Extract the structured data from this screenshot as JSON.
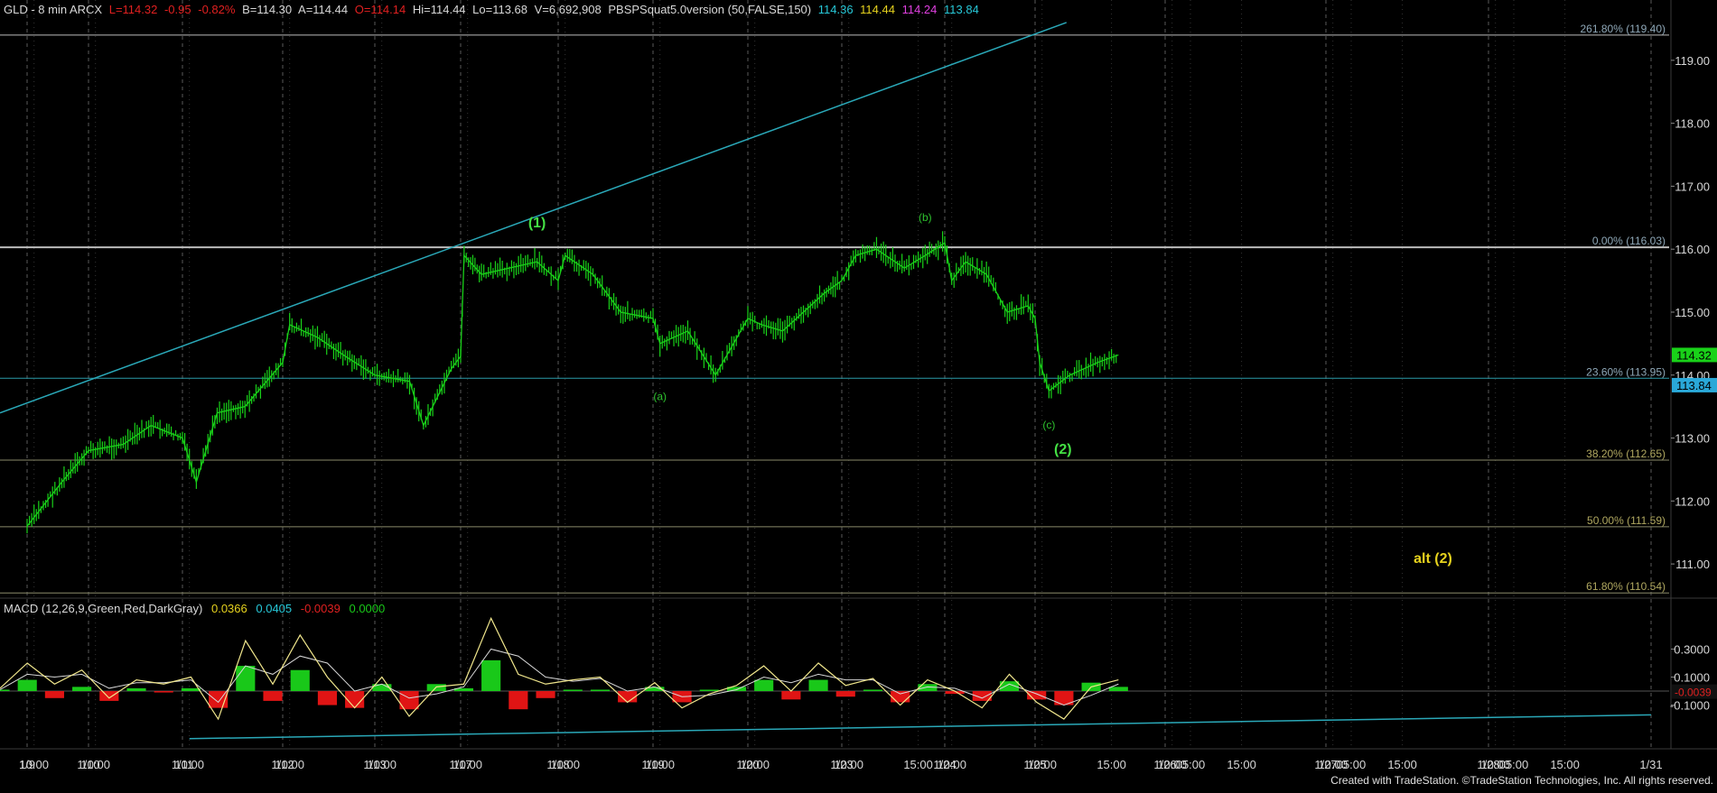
{
  "header": {
    "symbol": "GLD - 8 min  ARCX",
    "last": "L=114.32",
    "chg": "-0.95",
    "pct": "-0.82%",
    "bid": "B=114.30",
    "ask": "A=114.44",
    "open": "O=114.14",
    "hi": "Hi=114.44",
    "lo": "Lo=113.68",
    "vol": "V=6,692,908",
    "indicator": "PBSPSquat5.0version (50,FALSE,150)",
    "ind_v1": "114.36",
    "ind_v2": "114.44",
    "ind_v3": "114.24",
    "ind_v4": "113.84"
  },
  "macd_header": {
    "label": "MACD (12,26,9,Green,Red,DarkGray)",
    "v1": "0.0366",
    "v2": "0.0405",
    "v3": "-0.0039",
    "v4": "0.0000"
  },
  "colors": {
    "background": "#000000",
    "price": "#19d219",
    "trendline": "#2aa8b8",
    "fib_line": "#8a8a8a",
    "wave_label": "#2ec22e",
    "alt_label": "#e6d21e",
    "macd_line": "#f0e68c",
    "signal_line": "#d8d8d8",
    "hist_pos": "#19c819",
    "hist_neg": "#e01414",
    "cyan_text": "#27c8d8",
    "yellow_text": "#e6d21e",
    "magenta_text": "#e040e0",
    "red_text": "#e02020",
    "green_text": "#19c819"
  },
  "chart_data": [
    {
      "type": "line",
      "title": "GLD - 8 min ARCX",
      "y_range": [
        110.5,
        119.7
      ],
      "y_ticks": [
        "111.00",
        "112.00",
        "113.00",
        "114.00",
        "115.00",
        "116.00",
        "117.00",
        "118.00",
        "119.00"
      ],
      "x_tick_labels": [
        "1/9",
        "10:00",
        "1/10",
        "10:00",
        "1/11",
        "10:00",
        "1/12",
        "10:00",
        "1/13",
        "10:00",
        "1/17",
        "10:00",
        "1/18",
        "10:00",
        "1/19",
        "10:00",
        "1/20",
        "10:00",
        "1/23",
        "10:00",
        "15:00",
        "1/24",
        "10:00",
        "1/25",
        "10:00",
        "15:00",
        "1/26",
        "05:00",
        "10:00",
        "15:00",
        "1/27",
        "05:00",
        "10:00",
        "15:00",
        "1/28",
        "05:00",
        "10:00",
        "15:00",
        "1/31"
      ],
      "price_series": {
        "name": "GLD",
        "x": [
          "1/9 09:30",
          "1/9 12:00",
          "1/10 09:30",
          "1/10 12:00",
          "1/10 14:00",
          "1/11 09:30",
          "1/11 10:30",
          "1/11 12:00",
          "1/11 14:00",
          "1/12 09:30",
          "1/12 10:00",
          "1/12 12:00",
          "1/12 14:00",
          "1/13 09:30",
          "1/13 12:00",
          "1/13 13:00",
          "1/13 15:00",
          "1/17 09:30",
          "1/17 09:45",
          "1/17 11:00",
          "1/17 13:00",
          "1/17 15:00",
          "1/18 09:30",
          "1/18 10:00",
          "1/18 12:00",
          "1/18 14:00",
          "1/19 09:30",
          "1/19 10:00",
          "1/19 12:00",
          "1/19 14:00",
          "1/20 09:30",
          "1/20 10:30",
          "1/20 12:00",
          "1/20 15:00",
          "1/23 09:30",
          "1/23 10:30",
          "1/23 12:00",
          "1/23 14:00",
          "1/23 15:30",
          "1/24 09:30",
          "1/24 10:00",
          "1/24 11:00",
          "1/24 12:30",
          "1/24 14:00",
          "1/24 15:30",
          "1/25 09:30",
          "1/25 09:50",
          "1/25 10:30",
          "1/25 12:00",
          "1/25 14:00",
          "1/25 15:30"
        ],
        "values": [
          111.6,
          112.3,
          112.8,
          112.9,
          113.2,
          113.0,
          112.3,
          113.4,
          113.5,
          114.2,
          114.8,
          114.6,
          114.3,
          114.0,
          113.9,
          113.2,
          114.1,
          114.3,
          115.9,
          115.6,
          115.7,
          115.8,
          115.5,
          115.9,
          115.6,
          115.0,
          114.9,
          114.5,
          114.7,
          114.0,
          114.9,
          114.8,
          114.7,
          115.3,
          115.5,
          115.9,
          116.0,
          115.7,
          115.9,
          116.1,
          115.5,
          115.8,
          115.6,
          115.0,
          115.1,
          114.9,
          114.2,
          113.75,
          114.0,
          114.2,
          114.32
        ]
      },
      "fib_levels": [
        {
          "label": "261.80% (119.40)",
          "value": 119.4
        },
        {
          "label": "0.00% (116.03)",
          "value": 116.03
        },
        {
          "label": "23.60% (113.95)",
          "value": 113.95
        },
        {
          "label": "38.20% (112.65)",
          "value": 112.65
        },
        {
          "label": "50.00% (111.59)",
          "value": 111.59
        },
        {
          "label": "61.80% (110.54)",
          "value": 110.54
        }
      ],
      "trendlines": [
        {
          "from": [
            "1/9 09:30",
            113.4
          ],
          "to": [
            "1/26 05:00",
            119.6
          ]
        }
      ],
      "wave_labels": [
        {
          "text": "(1)",
          "x": "1/17 15:00",
          "y": 116.35
        },
        {
          "text": "(b)",
          "x": "1/23 15:30",
          "y": 116.45
        },
        {
          "text": "(a)",
          "x": "1/19 10:00",
          "y": 113.6
        },
        {
          "text": "(c)",
          "x": "1/25 10:30",
          "y": 113.15
        },
        {
          "text": "(2)",
          "x": "1/25 11:30",
          "y": 112.75
        }
      ],
      "alt_label": {
        "text": "alt (2)",
        "x": "1/27 12:00",
        "y": 111.3
      },
      "last_price_tags": [
        "114.32",
        "113.84"
      ],
      "grid": true
    },
    {
      "type": "line",
      "title": "MACD (12,26,9,Green,Red,DarkGray)",
      "y_range": [
        -0.38,
        0.58
      ],
      "y_ticks": [
        "0.3000",
        "0.1000",
        "-0.1000"
      ],
      "last_value_tag": "-0.0039",
      "series": [
        {
          "name": "MACD",
          "values": [
            0.02,
            0.2,
            0.05,
            0.15,
            -0.05,
            0.08,
            0.05,
            0.1,
            -0.2,
            0.36,
            0.05,
            0.4,
            0.1,
            -0.12,
            0.1,
            -0.18,
            0.03,
            0.05,
            0.52,
            0.12,
            0.05,
            0.08,
            0.1,
            -0.08,
            0.06,
            -0.12,
            -0.02,
            0.04,
            0.18,
            0.0,
            0.2,
            0.04,
            0.09,
            -0.1,
            0.08,
            0.0,
            -0.12,
            0.12,
            -0.08,
            -0.2,
            0.03,
            0.08
          ]
        },
        {
          "name": "Signal",
          "values": [
            0.01,
            0.12,
            0.1,
            0.12,
            0.02,
            0.06,
            0.06,
            0.08,
            -0.08,
            0.18,
            0.12,
            0.25,
            0.2,
            0.0,
            0.05,
            -0.05,
            -0.02,
            0.03,
            0.3,
            0.25,
            0.1,
            0.07,
            0.09,
            0.0,
            0.03,
            -0.04,
            -0.03,
            0.01,
            0.1,
            0.06,
            0.12,
            0.08,
            0.08,
            -0.02,
            0.03,
            0.02,
            -0.05,
            0.05,
            -0.02,
            -0.1,
            -0.03,
            0.05
          ]
        },
        {
          "name": "Histogram",
          "values": [
            0.01,
            0.08,
            -0.05,
            0.03,
            -0.07,
            0.02,
            -0.01,
            0.02,
            -0.12,
            0.18,
            -0.07,
            0.15,
            -0.1,
            -0.12,
            0.05,
            -0.13,
            0.05,
            0.02,
            0.22,
            -0.13,
            -0.05,
            0.01,
            0.01,
            -0.08,
            0.03,
            -0.08,
            0.01,
            0.03,
            0.08,
            -0.06,
            0.08,
            -0.04,
            0.01,
            -0.08,
            0.05,
            -0.02,
            -0.07,
            0.07,
            -0.06,
            -0.1,
            0.06,
            0.03
          ]
        }
      ],
      "trendline": {
        "from": [
          "1/11 10:00",
          -0.34
        ],
        "to": [
          "1/31",
          -0.17
        ]
      }
    }
  ],
  "footer": "Created with TradeStation. ©TradeStation Technologies, Inc. All rights reserved."
}
